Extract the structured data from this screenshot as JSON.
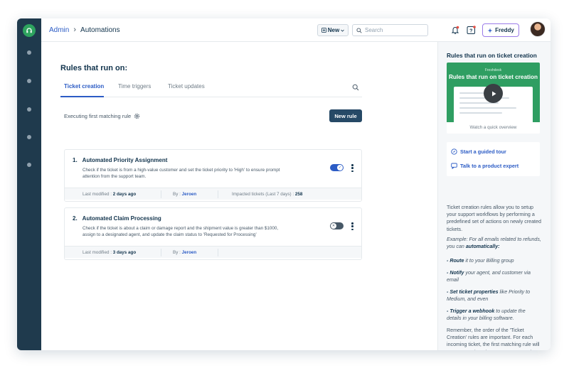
{
  "topbar": {
    "breadcrumb_root": "Admin",
    "breadcrumb_separator": "›",
    "breadcrumb_current": "Automations",
    "new_button": "New",
    "search_placeholder": "Search",
    "freddy_label": "Freddy"
  },
  "main": {
    "title": "Rules that run on:",
    "tabs": [
      {
        "label": "Ticket creation",
        "active": true
      },
      {
        "label": "Time triggers",
        "active": false
      },
      {
        "label": "Ticket updates",
        "active": false
      }
    ],
    "executing_label": "Executing first matching rule",
    "new_rule_button": "New rule",
    "rules": [
      {
        "number": "1.",
        "name": "Automated Priority Assignment",
        "description": "Check if the ticket is from a high-value customer and set the ticket priority to 'High' to ensure prompt attention from the support team.",
        "last_modified_label": "Last modified :",
        "last_modified_value": "2 days ago",
        "by_label": "By :",
        "by_value": "Jeroen",
        "impacted_label": "Impacted tickets (Last 7 days) :",
        "impacted_value": "258",
        "enabled": true
      },
      {
        "number": "2.",
        "name": "Automated Claim Processing",
        "description": "Check if the ticket is about a claim or damage report and the shipment value is greater than $1000, assign to a designated agent, and update the claim status to 'Requested for Processing'",
        "last_modified_label": "Last modified :",
        "last_modified_value": "3 days ago",
        "by_label": "By :",
        "by_value": "Jeroen",
        "enabled": false
      }
    ]
  },
  "panel": {
    "title": "Rules that run on ticket creation",
    "video_brand": "Freshdesk",
    "video_title": "Rules that run on ticket creation",
    "video_caption": "Watch a quick overview",
    "link_tour": "Start a guided tour",
    "link_expert": "Talk to a product expert",
    "intro": "Ticket creation rules allow you to setup your support workflows by performing a predefined set of actions on newly created tickets.",
    "example_prefix": "Example: For all emails related to refunds, you can ",
    "example_strong": "automatically:",
    "bullets": [
      {
        "strong": "- Route",
        "rest": " it to your Billing group"
      },
      {
        "strong": "- Notify",
        "rest": " your agent, and customer via email"
      },
      {
        "strong": "- Set ticket properties",
        "rest": " like Priority to Medium, and even"
      },
      {
        "strong": "- Trigger a webhook",
        "rest": " to update the details in your billing software."
      }
    ],
    "outro": "Remember, the order of the 'Ticket Creation' rules are important. For each incoming ticket, the first matching rule will get executed, and stop. You can reorder the list of rules to have the"
  },
  "colors": {
    "sidebar": "#1f3a4d",
    "accent_blue": "#2c5cc5",
    "primary_button": "#264966",
    "brand_green": "#2ea35f",
    "toggle_on": "#2c5cc5",
    "toggle_off": "#475867"
  },
  "icons": {
    "logo": "headset-icon",
    "bell": "bell-icon",
    "help": "help-icon",
    "store": "store-icon",
    "freddy": "sparkle-icon",
    "search": "search-icon",
    "settings": "gear-icon",
    "tour": "compass-icon",
    "chat": "chat-icon",
    "play": "play-icon"
  }
}
